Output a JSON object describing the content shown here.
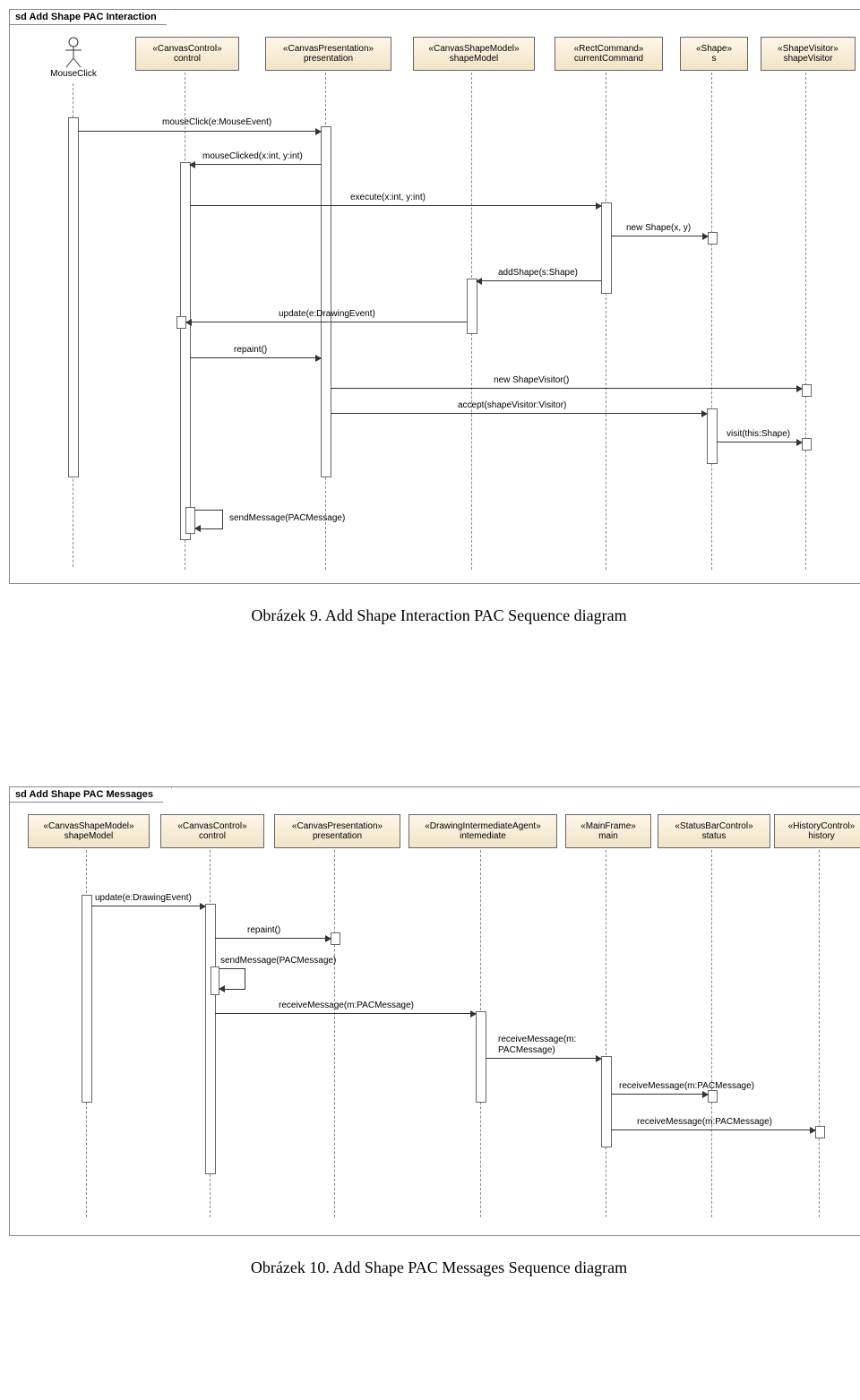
{
  "diagram1": {
    "frame_title": "sd Add Shape PAC Interaction",
    "actor": "MouseClick",
    "lifelines": {
      "control": {
        "stereo": "«CanvasControl»",
        "name": "control"
      },
      "presentation": {
        "stereo": "«CanvasPresentation»",
        "name": "presentation"
      },
      "shapeModel": {
        "stereo": "«CanvasShapeModel»",
        "name": "shapeModel"
      },
      "currentCommand": {
        "stereo": "«RectCommand»",
        "name": "currentCommand"
      },
      "s": {
        "stereo": "«Shape»",
        "name": "s"
      },
      "shapeVisitor": {
        "stereo": "«ShapeVisitor»",
        "name": "shapeVisitor"
      }
    },
    "messages": {
      "m1": "mouseClick(e:MouseEvent)",
      "m2": "mouseClicked(x:int, y:int)",
      "m3": "execute(x:int, y:int)",
      "m4": "new Shape(x, y)",
      "m5": "addShape(s:Shape)",
      "m6": "update(e:DrawingEvent)",
      "m7": "repaint()",
      "m8": "new ShapeVisitor()",
      "m9": "accept(shapeVisitor:Visitor)",
      "m10": "visit(this:Shape)",
      "m11": "sendMessage(PACMessage)"
    }
  },
  "caption1": "Obrázek 9.    Add Shape Interaction PAC Sequence diagram",
  "diagram2": {
    "frame_title": "sd Add Shape PAC Messages",
    "lifelines": {
      "shapeModel": {
        "stereo": "«CanvasShapeModel»",
        "name": "shapeModel"
      },
      "control": {
        "stereo": "«CanvasControl»",
        "name": "control"
      },
      "presentation": {
        "stereo": "«CanvasPresentation»",
        "name": "presentation"
      },
      "intermediate": {
        "stereo": "«DrawingIntermediateAgent»",
        "name": "intemediate"
      },
      "main": {
        "stereo": "«MainFrame»",
        "name": "main"
      },
      "status": {
        "stereo": "«StatusBarControl»",
        "name": "status"
      },
      "history": {
        "stereo": "«HistoryControl»",
        "name": "history"
      }
    },
    "messages": {
      "m1": "update(e:DrawingEvent)",
      "m2": "repaint()",
      "m3": "sendMessage(PACMessage)",
      "m4": "receiveMessage(m:PACMessage)",
      "m5a": "receiveMessage(m:",
      "m5b": "PACMessage)",
      "m6": "receiveMessage(m:PACMessage)",
      "m7": "receiveMessage(m:PACMessage)"
    }
  },
  "caption2": "Obrázek 10.    Add Shape PAC Messages Sequence diagram"
}
